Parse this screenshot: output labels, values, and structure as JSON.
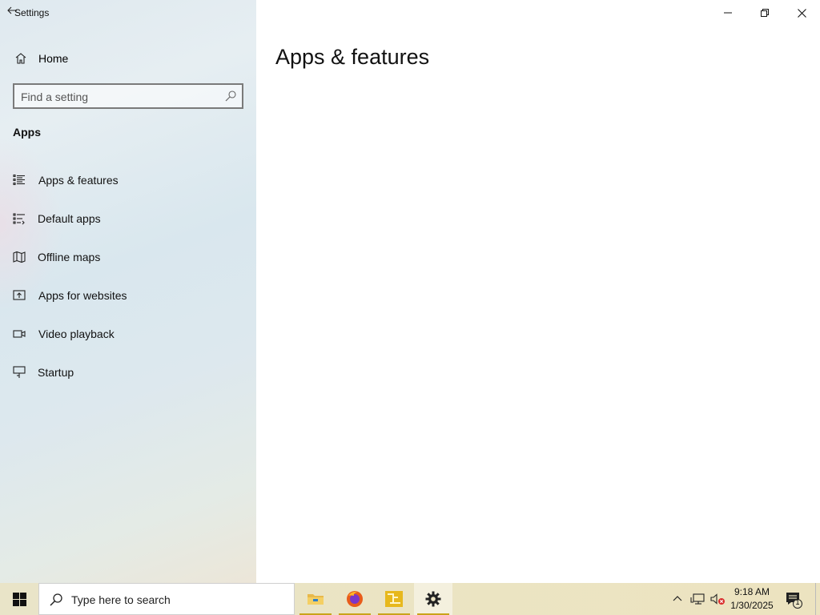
{
  "window": {
    "title": "Settings",
    "controls": {
      "minimize": "minimize",
      "maximize": "restore",
      "close": "close"
    }
  },
  "sidebar": {
    "home_label": "Home",
    "search_placeholder": "Find a setting",
    "section_title": "Apps",
    "items": [
      {
        "label": "Apps & features",
        "icon": "apps-features-icon"
      },
      {
        "label": "Default apps",
        "icon": "default-apps-icon"
      },
      {
        "label": "Offline maps",
        "icon": "map-icon"
      },
      {
        "label": "Apps for websites",
        "icon": "open-in-app-icon"
      },
      {
        "label": "Video playback",
        "icon": "video-icon"
      },
      {
        "label": "Startup",
        "icon": "startup-icon"
      }
    ]
  },
  "main": {
    "page_title": "Apps & features"
  },
  "taskbar": {
    "search_placeholder": "Type here to search",
    "apps": [
      "file-explorer-icon",
      "firefox-icon",
      "app-yellow-icon",
      "settings-gear-icon"
    ],
    "clock_time": "9:18 AM",
    "clock_date": "1/30/2025",
    "notification_count": "1"
  },
  "colors": {
    "accent": "#c9a31a",
    "taskbar": "#ebe4c3"
  }
}
